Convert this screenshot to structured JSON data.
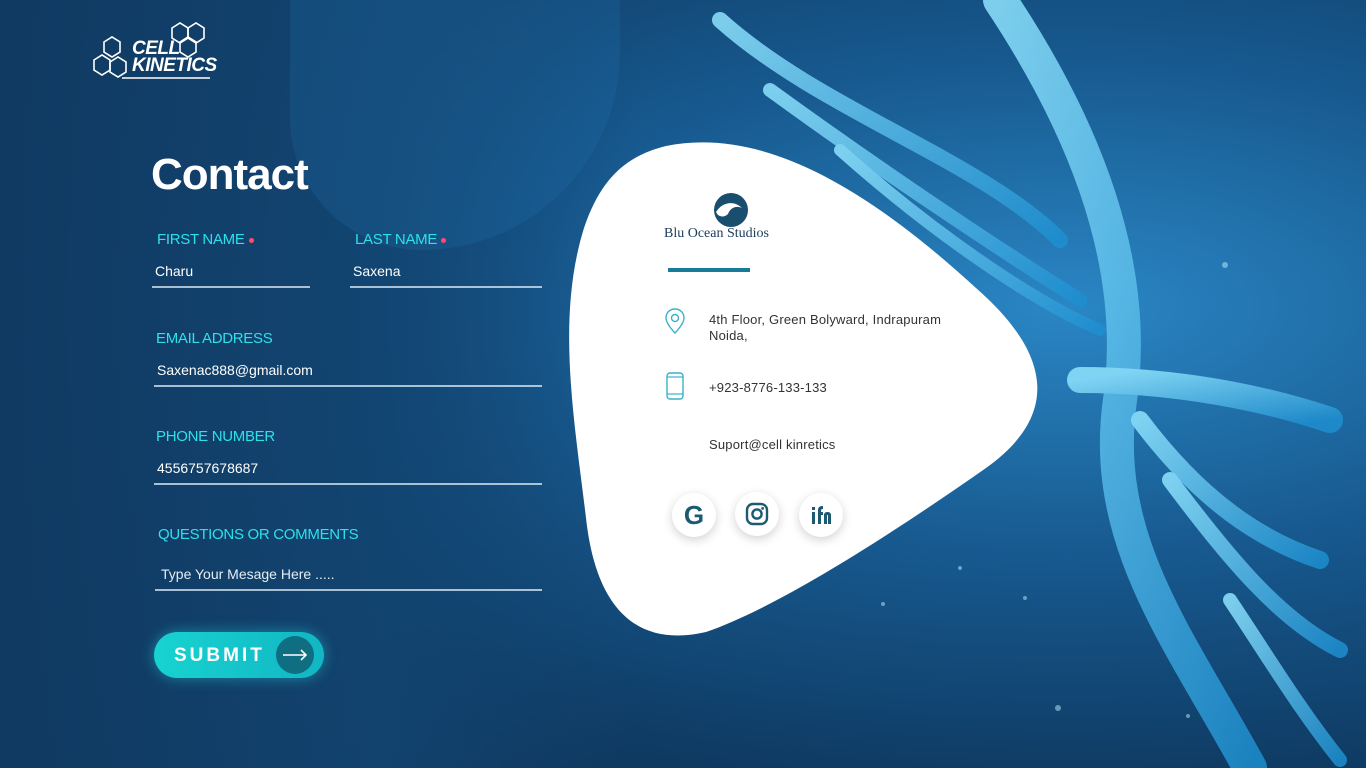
{
  "logo": {
    "line1": "CELL",
    "line2": "KINETICS"
  },
  "form": {
    "title": "Contact",
    "first_name": {
      "label": "FIRST NAME",
      "value": "Charu"
    },
    "last_name": {
      "label": "LAST NAME",
      "value": "Saxena"
    },
    "email": {
      "label": "EMAIL ADDRESS",
      "value": "Saxenac888@gmail.com"
    },
    "phone": {
      "label": "PHONE NUMBER",
      "value": "4556757678687"
    },
    "comments": {
      "label": "QUESTIONS OR COMMENTS",
      "placeholder": "Type Your Mesage Here ....."
    },
    "submit_label": "SUBMIT"
  },
  "card": {
    "brand": "Blu Ocean Studios",
    "address_line1": "4th Floor, Green Bolyward, Indrapuram",
    "address_line2": "Noida,",
    "phone": "+923-8776-133-133",
    "email": "Suport@cell kinretics"
  },
  "social": [
    "google-icon",
    "instagram-icon",
    "ifn-icon"
  ],
  "colors": {
    "accent": "#2ee0ea",
    "button": "#17d3d0",
    "required": "#ff4a6e",
    "card_text": "#333333"
  }
}
